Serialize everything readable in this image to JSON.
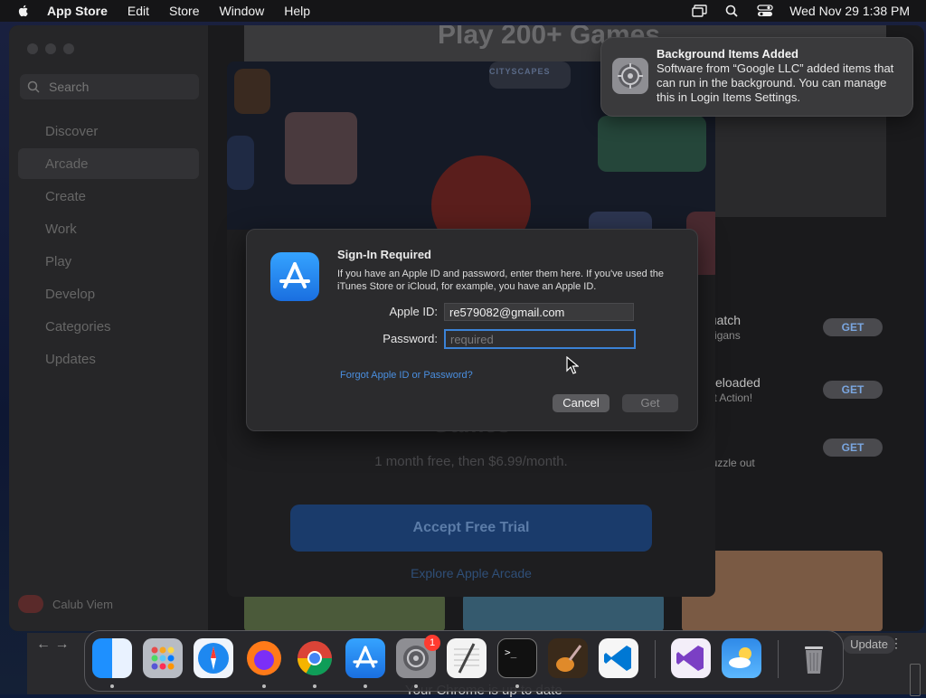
{
  "menubar": {
    "app_name": "App Store",
    "menus": [
      "Edit",
      "Store",
      "Window",
      "Help"
    ],
    "datetime": "Wed Nov 29  1:38 PM"
  },
  "sidebar": {
    "search_placeholder": "Search",
    "items": [
      "Discover",
      "Arcade",
      "Create",
      "Work",
      "Play",
      "Develop",
      "Categories",
      "Updates"
    ],
    "active_item": "Arcade",
    "profile_name": "Calub Viem"
  },
  "main": {
    "hero_text": "Play 200+ Games",
    "games": [
      {
        "name": "squatch",
        "sub": "nanigans",
        "button": "GET"
      },
      {
        "name": "s Reloaded",
        "sub": "shot Action!",
        "button": "GET"
      },
      {
        "name": "e",
        "sub": "o puzzle out",
        "button": "GET"
      }
    ]
  },
  "arcade": {
    "art_label": "CITYSCAPES",
    "title": "Games",
    "price": "1 month free, then $6.99/month.",
    "trial_button": "Accept Free Trial",
    "explore_link": "Explore Apple Arcade"
  },
  "dialog": {
    "title": "Sign-In Required",
    "description": "If you have an Apple ID and password, enter them here. If you've used the iTunes Store or iCloud, for example, you have an Apple ID.",
    "apple_id_label": "Apple ID:",
    "apple_id_value": "re579082@gmail.com",
    "password_label": "Password:",
    "password_placeholder": "required",
    "forgot_link": "Forgot Apple ID or Password?",
    "cancel": "Cancel",
    "get": "Get"
  },
  "notification": {
    "title": "Background Items Added",
    "body": "Software from “Google LLC” added items that can run in the background. You can manage this in Login Items Settings."
  },
  "chrome": {
    "update_label": "Update",
    "status": "Your Chrome is up to date"
  },
  "dock": {
    "settings_badge": "1"
  },
  "colors": {
    "accent": "#3b82d6",
    "link": "#4a8fe0",
    "badge": "#ff3b30"
  }
}
